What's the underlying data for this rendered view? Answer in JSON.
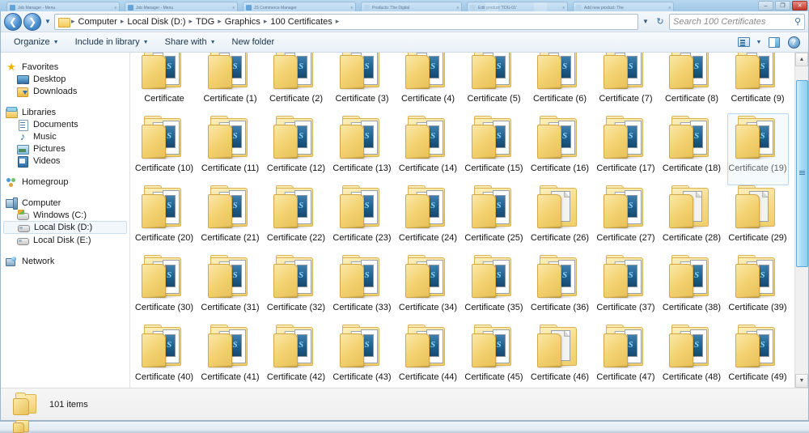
{
  "background_window": {
    "tabs": [
      {
        "title": "Job Manager - Menu",
        "favicon": "favicon-blue",
        "close": "x"
      },
      {
        "title": "Job Manager - Menu",
        "favicon": "favicon-blue",
        "close": "x"
      },
      {
        "title": "JS Commerce Manager",
        "favicon": "favicon-blue",
        "close": "x"
      },
      {
        "title": "Products: The Digital",
        "favicon": "favicon-pale",
        "close": "x"
      },
      {
        "title": "Edit product 'TDG-01'",
        "favicon": "favicon-pale",
        "close": "x"
      },
      {
        "title": "Add new product: The",
        "favicon": "favicon-pale",
        "close": "x"
      }
    ],
    "window_controls": {
      "minimize": "–",
      "restore": "❐",
      "close": "✕"
    }
  },
  "addressbar": {
    "back_icon": "back-arrow-icon",
    "forward_icon": "forward-arrow-icon",
    "history_icon": "chevron-down-icon",
    "breadcrumb": [
      "Computer",
      "Local Disk (D:)",
      "TDG",
      "Graphics",
      "100 Certificates"
    ],
    "separator": "▸",
    "dropdown_icon": "chevron-down-icon",
    "refresh_icon": "refresh-icon",
    "search": {
      "placeholder": "Search 100 Certificates",
      "value": "",
      "icon": "search-icon"
    }
  },
  "commandbar": {
    "items": [
      {
        "label": "Organize",
        "has_caret": true
      },
      {
        "label": "Include in library",
        "has_caret": true
      },
      {
        "label": "Share with",
        "has_caret": true
      },
      {
        "label": "New folder",
        "has_caret": false
      }
    ],
    "right_icons": [
      "change-view-icon",
      "view-caret-icon",
      "preview-pane-icon",
      "help-icon"
    ],
    "help_glyph": "?"
  },
  "sidebar": {
    "groups": [
      {
        "header": {
          "label": "Favorites",
          "icon": "star-icon",
          "icon_class": "star",
          "glyph": "★"
        },
        "items": [
          {
            "label": "Desktop",
            "icon": "desktop-icon",
            "icon_class": "desk"
          },
          {
            "label": "Downloads",
            "icon": "downloads-icon",
            "icon_class": "dl"
          }
        ]
      },
      {
        "header": {
          "label": "Libraries",
          "icon": "libraries-icon",
          "icon_class": "lib",
          "glyph": ""
        },
        "items": [
          {
            "label": "Documents",
            "icon": "documents-icon",
            "icon_class": "doc"
          },
          {
            "label": "Music",
            "icon": "music-icon",
            "icon_class": "mus",
            "glyph": "♪"
          },
          {
            "label": "Pictures",
            "icon": "pictures-icon",
            "icon_class": "pic"
          },
          {
            "label": "Videos",
            "icon": "videos-icon",
            "icon_class": "vid"
          }
        ]
      },
      {
        "header": {
          "label": "Homegroup",
          "icon": "homegroup-icon",
          "icon_class": "home",
          "glyph": ""
        },
        "items": []
      },
      {
        "header": {
          "label": "Computer",
          "icon": "computer-icon",
          "icon_class": "comp",
          "glyph": ""
        },
        "items": [
          {
            "label": "Windows (C:)",
            "icon": "windows-drive-icon",
            "icon_class": "drvwin",
            "selected": false
          },
          {
            "label": "Local Disk (D:)",
            "icon": "drive-icon",
            "icon_class": "drv",
            "selected": true
          },
          {
            "label": "Local Disk (E:)",
            "icon": "drive-icon",
            "icon_class": "drv",
            "selected": false
          }
        ]
      },
      {
        "header": {
          "label": "Network",
          "icon": "network-icon",
          "icon_class": "net",
          "glyph": ""
        },
        "items": []
      }
    ]
  },
  "content": {
    "columns": 10,
    "selected_item": "Certificate (19)",
    "items": [
      {
        "label": "Certificate",
        "thumb": "two-psd"
      },
      {
        "label": "Certificate (1)",
        "thumb": "two-psd"
      },
      {
        "label": "Certificate (2)",
        "thumb": "two-psd"
      },
      {
        "label": "Certificate (3)",
        "thumb": "two-psd"
      },
      {
        "label": "Certificate (4)",
        "thumb": "two-psd"
      },
      {
        "label": "Certificate (5)",
        "thumb": "two-psd"
      },
      {
        "label": "Certificate (6)",
        "thumb": "two-psd"
      },
      {
        "label": "Certificate (7)",
        "thumb": "two-psd"
      },
      {
        "label": "Certificate (8)",
        "thumb": "two-psd"
      },
      {
        "label": "Certificate (9)",
        "thumb": "two-psd"
      },
      {
        "label": "Certificate (10)",
        "thumb": "two-psd"
      },
      {
        "label": "Certificate (11)",
        "thumb": "two-psd"
      },
      {
        "label": "Certificate (12)",
        "thumb": "two-psd"
      },
      {
        "label": "Certificate (13)",
        "thumb": "two-psd"
      },
      {
        "label": "Certificate (14)",
        "thumb": "two-psd"
      },
      {
        "label": "Certificate (15)",
        "thumb": "two-psd"
      },
      {
        "label": "Certificate (16)",
        "thumb": "two-psd"
      },
      {
        "label": "Certificate (17)",
        "thumb": "two-psd"
      },
      {
        "label": "Certificate (18)",
        "thumb": "two-psd"
      },
      {
        "label": "Certificate (19)",
        "thumb": "one-psd"
      },
      {
        "label": "Certificate (20)",
        "thumb": "two-psd"
      },
      {
        "label": "Certificate (21)",
        "thumb": "two-psd"
      },
      {
        "label": "Certificate (22)",
        "thumb": "two-psd"
      },
      {
        "label": "Certificate (23)",
        "thumb": "two-psd"
      },
      {
        "label": "Certificate (24)",
        "thumb": "two-psd"
      },
      {
        "label": "Certificate (25)",
        "thumb": "two-psd"
      },
      {
        "label": "Certificate (26)",
        "thumb": "blank"
      },
      {
        "label": "Certificate (27)",
        "thumb": "one-psd"
      },
      {
        "label": "Certificate (28)",
        "thumb": "blank"
      },
      {
        "label": "Certificate (29)",
        "thumb": "blank"
      },
      {
        "label": "Certificate (30)",
        "thumb": "two-psd"
      },
      {
        "label": "Certificate (31)",
        "thumb": "two-psd"
      },
      {
        "label": "Certificate (32)",
        "thumb": "two-psd"
      },
      {
        "label": "Certificate (33)",
        "thumb": "two-psd"
      },
      {
        "label": "Certificate (34)",
        "thumb": "two-psd"
      },
      {
        "label": "Certificate (35)",
        "thumb": "two-psd"
      },
      {
        "label": "Certificate (36)",
        "thumb": "two-psd"
      },
      {
        "label": "Certificate (37)",
        "thumb": "two-psd"
      },
      {
        "label": "Certificate (38)",
        "thumb": "two-psd"
      },
      {
        "label": "Certificate (39)",
        "thumb": "two-psd"
      },
      {
        "label": "Certificate (40)",
        "thumb": "two-psd"
      },
      {
        "label": "Certificate (41)",
        "thumb": "two-psd"
      },
      {
        "label": "Certificate (42)",
        "thumb": "two-psd"
      },
      {
        "label": "Certificate (43)",
        "thumb": "two-psd"
      },
      {
        "label": "Certificate (44)",
        "thumb": "two-psd"
      },
      {
        "label": "Certificate (45)",
        "thumb": "two-psd"
      },
      {
        "label": "Certificate (46)",
        "thumb": "blank"
      },
      {
        "label": "Certificate (47)",
        "thumb": "two-psd"
      },
      {
        "label": "Certificate (48)",
        "thumb": "two-psd"
      },
      {
        "label": "Certificate (49)",
        "thumb": "two-psd"
      }
    ],
    "scrollbar": {
      "up_glyph": "▲",
      "down_glyph": "▼",
      "thumb_top_pct": 4,
      "thumb_height_pct": 56
    }
  },
  "statusbar": {
    "icon": "folder-icon",
    "text": "101 items"
  },
  "taskbar": {
    "icon": "folder-icon"
  }
}
